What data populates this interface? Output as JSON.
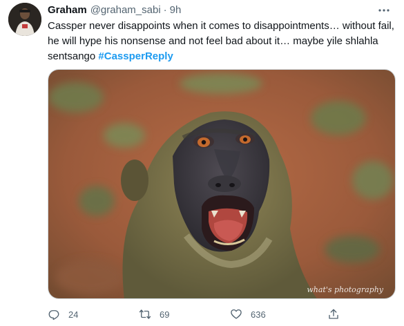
{
  "tweet": {
    "author_name": "Graham",
    "author_handle": "@graham_sabi",
    "separator": "·",
    "time": "9h",
    "text": "Cassper never disappoints when it comes to disappointments… without fail, he will hype his nonsense and not feel bad about it… maybe yile shlahla sentsango",
    "hashtag": "#CassperReply",
    "media_watermark": "what's photography",
    "more_icon": "more-dots-icon"
  },
  "actions": {
    "reply_count": "24",
    "retweet_count": "69",
    "like_count": "636",
    "reply_icon": "reply-icon",
    "retweet_icon": "retweet-icon",
    "like_icon": "heart-icon",
    "share_icon": "share-icon"
  },
  "colors": {
    "accent": "#1d9bf0",
    "secondary_text": "#536471",
    "primary_text": "#0f1419"
  }
}
